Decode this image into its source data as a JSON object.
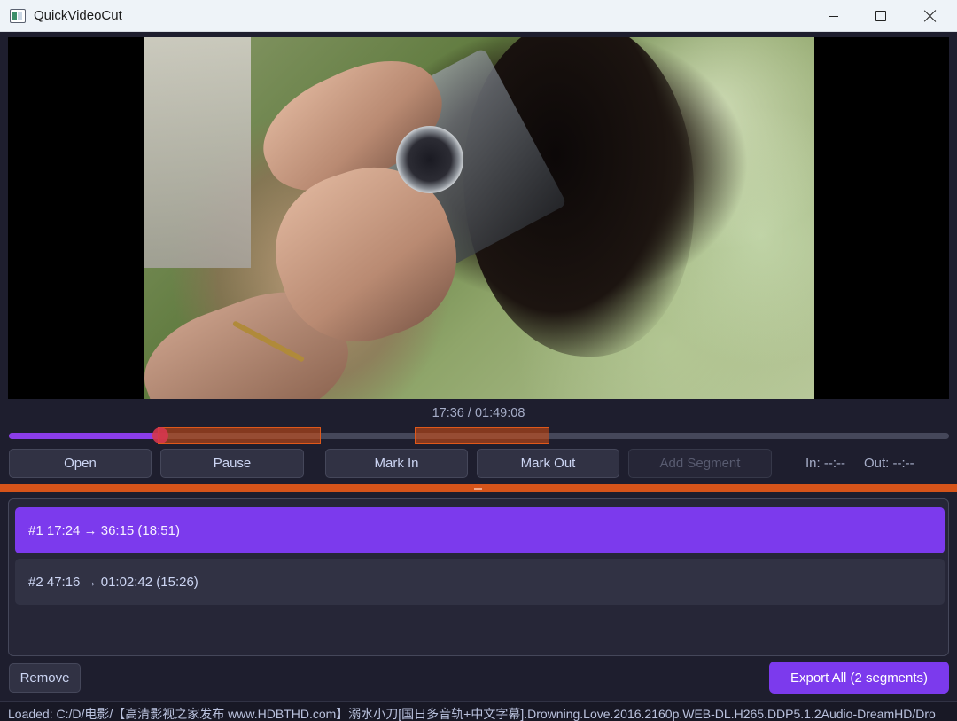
{
  "window": {
    "title": "QuickVideoCut"
  },
  "player": {
    "time_display": "17:36 / 01:49:08",
    "progress_fraction": 0.161
  },
  "controls": {
    "open": "Open",
    "pause": "Pause",
    "mark_in": "Mark In",
    "mark_out": "Mark Out",
    "add_segment": "Add Segment",
    "in_label": "In: --:--",
    "out_label": "Out: --:--"
  },
  "segments": [
    {
      "label": "#1  17:24 → 36:15  (18:51)",
      "selected": true
    },
    {
      "label": "#2  47:16 → 01:02:42  (15:26)",
      "selected": false
    }
  ],
  "actions": {
    "remove": "Remove",
    "export_all": "Export All (2 segments)"
  },
  "status": {
    "text": "Loaded: C:/D/电影/【高清影视之家发布 www.HDBTHD.com】溺水小刀[国日多音轨+中文字幕].Drowning.Love.2016.2160p.WEB-DL.H265.DDP5.1.2Audio-DreamHD/Dro"
  },
  "colors": {
    "accent": "#7c3aed",
    "segment_marker": "#d6541a",
    "playhead": "#d6364c",
    "background": "#1e1e2e"
  }
}
